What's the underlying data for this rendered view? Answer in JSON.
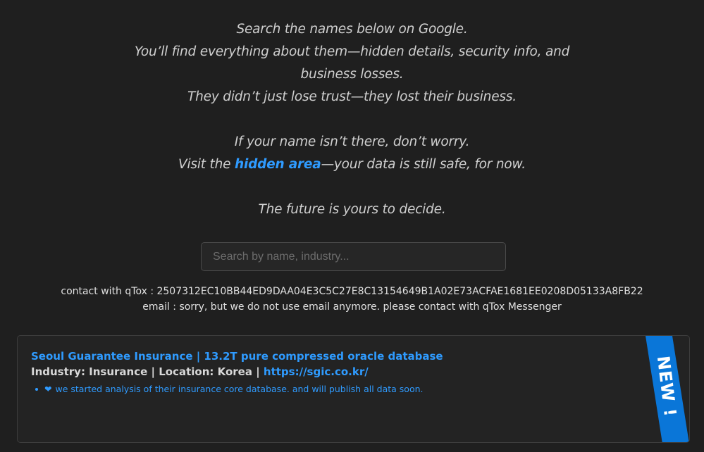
{
  "intro": {
    "line1": "Search the names below on Google.",
    "line2": "You’ll find everything about them—hidden details, security info, and",
    "line3": "business losses.",
    "line4": "They didn’t just lose trust—they lost their business.",
    "line5": "If your name isn’t there, don’t worry.",
    "line6_pre": "Visit the ",
    "line6_link": "hidden area",
    "line6_post": "—your data is still safe, for now.",
    "line7": "The future is yours to decide."
  },
  "search": {
    "placeholder": "Search by name, industry...",
    "value": ""
  },
  "contact": {
    "qtox_line": "contact with qTox : 2507312EC10BB44ED9DAA04E3C5C27E8C13154649B1A02E73ACFAE1681EE0208D05133A8FB22",
    "email_line": "email : sorry, but we do not use email anymore. please contact with qTox Messenger"
  },
  "cards": [
    {
      "title": "Seoul Guarantee Insurance | 13.2T pure compressed oracle database",
      "meta_prefix": "Industry: Insurance | Location: Korea | ",
      "link": "https://sgic.co.kr/",
      "note_icon": "❤",
      "note": "we started analysis of their insurance core database. and will publish all data soon.",
      "ribbon": "NEW !"
    }
  ],
  "colors": {
    "background": "#1f1f1f",
    "accent": "#2f9bff",
    "ribbon": "#0a76d8"
  }
}
